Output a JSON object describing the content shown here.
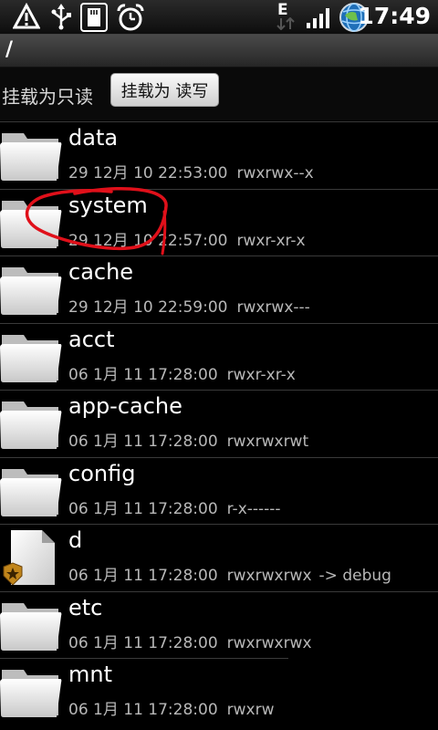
{
  "status_bar": {
    "icons": [
      "warning-icon",
      "usb-icon",
      "sd-card-icon",
      "alarm-icon",
      "edge-data-icon",
      "signal-icon",
      "sync-icon"
    ],
    "network_label": "E",
    "time": "17:49"
  },
  "path_bar": {
    "path": "/"
  },
  "mount": {
    "status_text": "挂载为只读",
    "button_label": "挂载为 读写"
  },
  "files": [
    {
      "name": "data",
      "time": "29 12月 10 22:53:00",
      "perms": "rwxrwx--x",
      "type": "folder"
    },
    {
      "name": "system",
      "time": "29 12月 10 22:57:00",
      "perms": "rwxr-xr-x",
      "type": "folder"
    },
    {
      "name": "cache",
      "time": "29 12月 10 22:59:00",
      "perms": "rwxrwx---",
      "type": "folder"
    },
    {
      "name": "acct",
      "time": "06 1月 11 17:28:00",
      "perms": "rwxr-xr-x",
      "type": "folder"
    },
    {
      "name": "app-cache",
      "time": "06 1月 11 17:28:00",
      "perms": "rwxrwxrwt",
      "type": "folder"
    },
    {
      "name": "config",
      "time": "06 1月 11 17:28:00",
      "perms": "r-x------",
      "type": "folder"
    },
    {
      "name": "d",
      "time": "06 1月 11 17:28:00",
      "perms": "rwxrwxrwx",
      "link": "-> debug",
      "type": "symlink"
    },
    {
      "name": "etc",
      "time": "06 1月 11 17:28:00",
      "perms": "rwxrwxrwx",
      "type": "folder"
    },
    {
      "name": "mnt",
      "time": "06 1月 11 17:28:00",
      "perms": "rwxrw",
      "type": "folder"
    }
  ],
  "colors": {
    "annotation_circle": "#e0101a",
    "row_divider": "#3a3a3a",
    "meta_text": "#b8b8b8"
  }
}
